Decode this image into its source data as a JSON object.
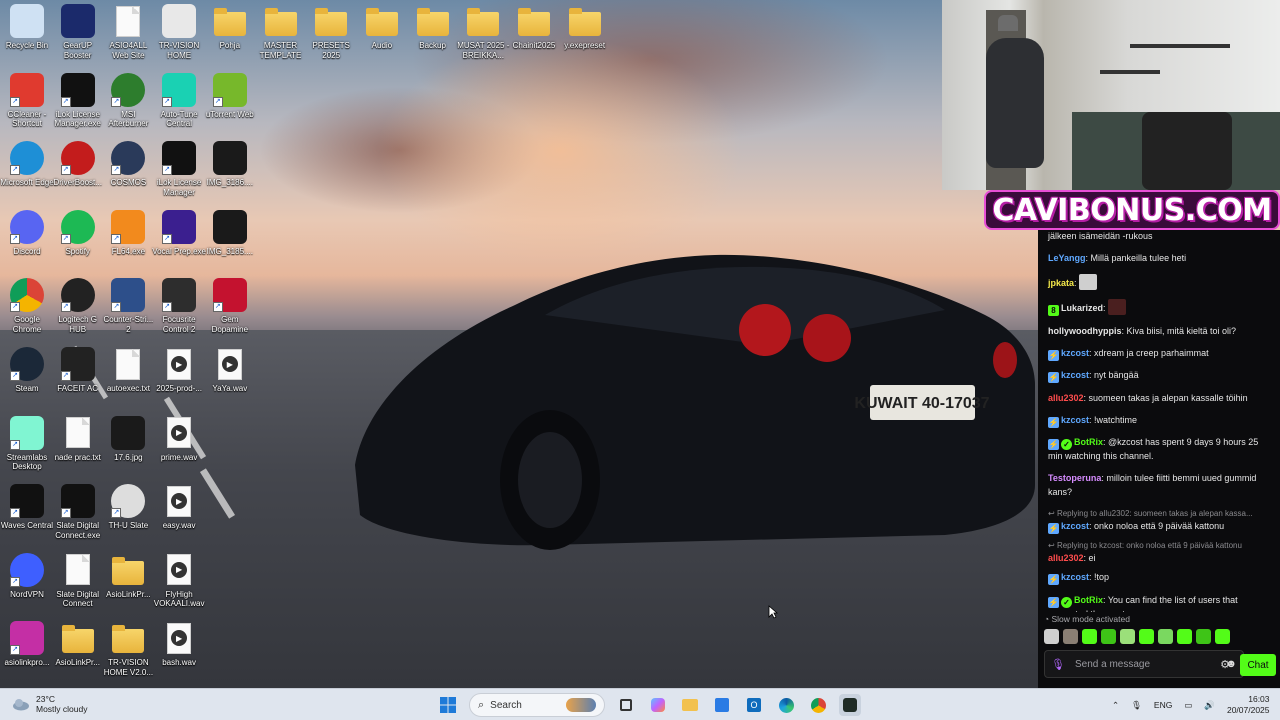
{
  "desktop": {
    "icons": [
      {
        "label": "Recycle Bin",
        "icon": "recycle-bin-icon"
      },
      {
        "label": "GearUP Booster",
        "icon": "gearup-icon"
      },
      {
        "label": "ASIO4ALL Web Site",
        "icon": "document-icon"
      },
      {
        "label": "TR-VISION HOME",
        "icon": "app-tile-icon"
      },
      {
        "label": "Pohja",
        "icon": "folder-icon"
      },
      {
        "label": "MASTER TEMPLATE",
        "icon": "folder-icon"
      },
      {
        "label": "PRESETS 2025",
        "icon": "folder-icon"
      },
      {
        "label": "Audio",
        "icon": "folder-icon"
      },
      {
        "label": "Backup",
        "icon": "folder-icon"
      },
      {
        "label": "MUSAT 2025 - BREIKKA...",
        "icon": "folder-icon"
      },
      {
        "label": "Chainit2025",
        "icon": "folder-icon"
      },
      {
        "label": "y.exepreset",
        "icon": "folder-icon"
      },
      {
        "label": "CCleaner - Shortcut",
        "icon": "ccleaner-icon"
      },
      {
        "label": "iLok License Manager.exe",
        "icon": "ilok-icon"
      },
      {
        "label": "MSI Afterburner",
        "icon": "msi-afterburner-icon"
      },
      {
        "label": "Auto-Tune Central",
        "icon": "autotune-icon"
      },
      {
        "label": "uTorrent Web",
        "icon": "utorrent-icon"
      },
      {
        "label": "Microsoft Edge",
        "icon": "edge-icon"
      },
      {
        "label": "DriverBoost...",
        "icon": "driverbooster-icon"
      },
      {
        "label": "COSMOS",
        "icon": "cosmos-icon"
      },
      {
        "label": "iLok License Manager",
        "icon": "ilok-icon"
      },
      {
        "label": "IMG_3186....",
        "icon": "image-file-icon"
      },
      {
        "label": "Discord",
        "icon": "discord-icon"
      },
      {
        "label": "Spotify",
        "icon": "spotify-icon"
      },
      {
        "label": "FL64.exe",
        "icon": "fl-studio-icon"
      },
      {
        "label": "Vocal Prep.exe",
        "icon": "vocalprep-icon"
      },
      {
        "label": "IMG_3185....",
        "icon": "image-file-icon"
      },
      {
        "label": "Google Chrome",
        "icon": "chrome-icon"
      },
      {
        "label": "Logitech G HUB",
        "icon": "ghub-icon"
      },
      {
        "label": "Counter-Stri... 2",
        "icon": "cs2-icon"
      },
      {
        "label": "Focusrite Control 2",
        "icon": "focusrite-icon"
      },
      {
        "label": "Gem Dopamine",
        "icon": "gem-icon"
      },
      {
        "label": "Steam",
        "icon": "steam-icon"
      },
      {
        "label": "FACEIT AC",
        "icon": "faceit-icon"
      },
      {
        "label": "autoexec.txt",
        "icon": "document-icon"
      },
      {
        "label": "2025-prod-...",
        "icon": "wav-file-icon"
      },
      {
        "label": "YaYa.wav",
        "icon": "wav-file-icon"
      },
      {
        "label": "Streamlabs Desktop",
        "icon": "streamlabs-icon"
      },
      {
        "label": "nade prac.txt",
        "icon": "document-icon"
      },
      {
        "label": "17.6.jpg",
        "icon": "image-file-icon"
      },
      {
        "label": "prime.wav",
        "icon": "wav-file-icon"
      },
      {
        "label": "Waves Central",
        "icon": "waves-icon"
      },
      {
        "label": "Slate Digital Connect.exe",
        "icon": "slate-icon"
      },
      {
        "label": "TH-U Slate",
        "icon": "thu-icon"
      },
      {
        "label": "easy.wav",
        "icon": "wav-file-icon"
      },
      {
        "label": "NordVPN",
        "icon": "nordvpn-icon"
      },
      {
        "label": "Slate Digital Connect",
        "icon": "document-icon"
      },
      {
        "label": "AsioLinkPr...",
        "icon": "folder-icon"
      },
      {
        "label": "FlyHigh VOKAALI.wav",
        "icon": "wav-file-icon"
      },
      {
        "label": "asiolinkpro...",
        "icon": "asiolink-icon"
      },
      {
        "label": "AsioLinkPr...",
        "icon": "folder-icon"
      },
      {
        "label": "TR-VISION HOME V2.0...",
        "icon": "folder-icon"
      },
      {
        "label": "bash.wav",
        "icon": "wav-file-icon"
      }
    ]
  },
  "stream": {
    "banner": "CAVIBONUS.COM"
  },
  "chat": {
    "messages": [
      {
        "type": "text",
        "user": "",
        "text": "jälkeen isämeidän -rukous"
      },
      {
        "type": "text",
        "user": "LeYangg",
        "user_color": "#5fa8ff",
        "text": "Millä pankeilla tulee heti"
      },
      {
        "type": "emote",
        "user": "jpkata",
        "user_color": "#f4e94b",
        "text": ""
      },
      {
        "type": "emote",
        "user": "Lukarized",
        "user_color": "#e6e6e6",
        "text": ""
      },
      {
        "type": "text",
        "user": "hollywoodhyppis",
        "user_color": "#e6e6e6",
        "text": "Kiva biisi, mitä kieltä toi oli?"
      },
      {
        "type": "text",
        "user": "kzcost",
        "user_color": "#5fa8ff",
        "text": "xdream ja creep parhaimmat"
      },
      {
        "type": "text",
        "user": "kzcost",
        "user_color": "#5fa8ff",
        "text": "nyt bängää"
      },
      {
        "type": "text",
        "user": "allu2302",
        "user_color": "#ff4d4d",
        "text": "suomeen takas ja alepan kassalle töihin"
      },
      {
        "type": "text",
        "user": "kzcost",
        "user_color": "#5fa8ff",
        "text": "!watchtime"
      },
      {
        "type": "text",
        "user": "BotRix",
        "user_color": "#53fc18",
        "text": "@kzcost has spent 9 days 9 hours 25 min watching this channel."
      },
      {
        "type": "text",
        "user": "Testoperuna",
        "user_color": "#d68cff",
        "text": "milloin tulee fiitti bemmi uued gummid kans?"
      },
      {
        "type": "reply",
        "reply": "Replying to allu2302: suomeen takas ja alepan kassa...",
        "user": "kzcost",
        "user_color": "#5fa8ff",
        "text": "onko noloa että 9 päivää kattonu"
      },
      {
        "type": "reply",
        "reply": "Replying to kzcost: onko noloa että 9 päivää kattonu",
        "user": "allu2302",
        "user_color": "#ff4d4d",
        "text": "ei"
      },
      {
        "type": "text",
        "user": "kzcost",
        "user_color": "#5fa8ff",
        "text": "!top"
      },
      {
        "type": "link",
        "user": "BotRix",
        "user_color": "#53fc18",
        "text": "You can find the list of users that supported the most:",
        "link": "https://botrix.live/k/oscaviar/leaderboard"
      }
    ],
    "slow_mode": "Slow mode activated",
    "input_placeholder": "Send a message",
    "send_label": "Chat"
  },
  "taskbar": {
    "weather_temp": "23°C",
    "weather_desc": "Mostly cloudy",
    "search_label": "Search",
    "language": "ENG",
    "time": "16:03",
    "date": "20/07/2025"
  }
}
